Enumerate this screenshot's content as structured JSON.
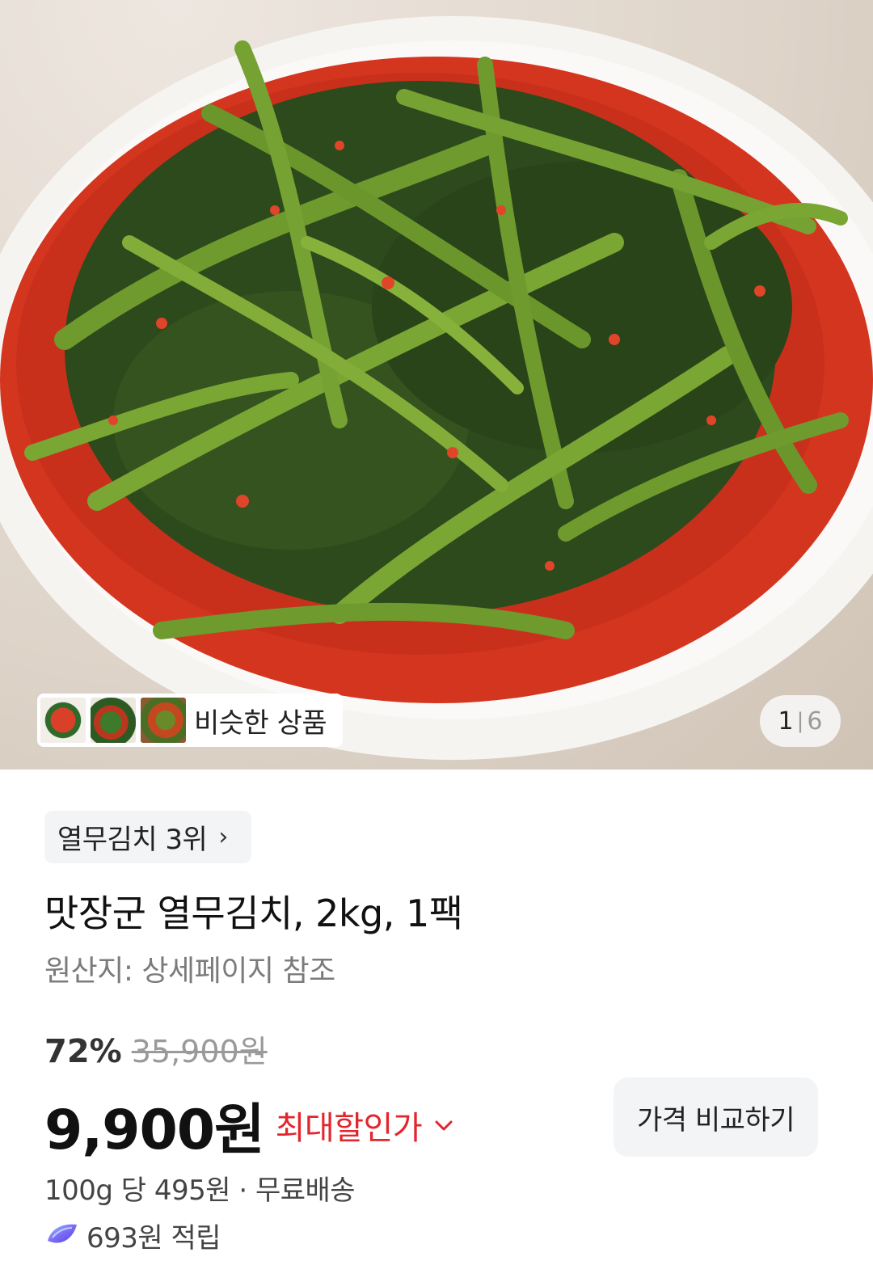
{
  "gallery": {
    "similar_label": "비슷한 상품",
    "current_index": "1",
    "separator": "|",
    "total": "6"
  },
  "product": {
    "rank_badge": "열무김치 3위",
    "title": "맛장군 열무김치, 2kg, 1팩",
    "origin": "원산지: 상세페이지 참조",
    "discount_percent": "72%",
    "original_price": "35,900원",
    "price": "9,900원",
    "max_discount_label": "최대할인가",
    "compare_button": "가격 비교하기",
    "unit_price_shipping": "100g 당 495원 · 무료배송",
    "reward": "693원 적립"
  },
  "colors": {
    "accent_red": "#e2262d",
    "badge_bg": "#f3f4f6"
  },
  "icons": {
    "rank_chevron": "chevron-right-icon",
    "discount_chevron": "chevron-down-icon",
    "reward": "reward-gem-icon"
  }
}
